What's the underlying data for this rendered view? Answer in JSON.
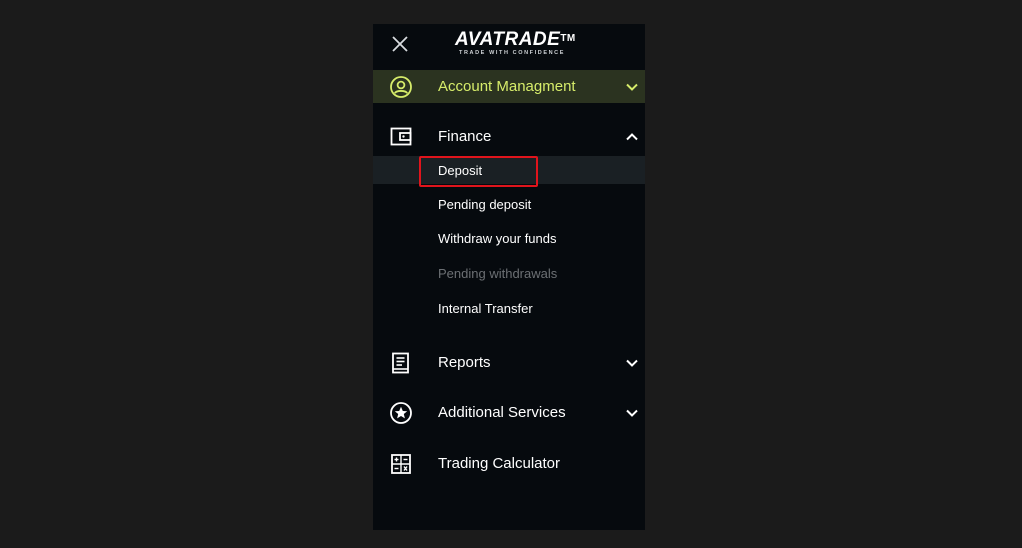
{
  "brand": {
    "name": "AVATRADE",
    "trademark": "TM",
    "tagline": "TRADE WITH CONFIDENCE"
  },
  "colors": {
    "panel_bg": "#060a0e",
    "active_bg": "#2b3320",
    "active_text": "#d6ec6a",
    "highlight": "#e0141c"
  },
  "menu": {
    "account": {
      "label": "Account Managment",
      "icon": "user-circle-icon",
      "expanded": false
    },
    "finance": {
      "label": "Finance",
      "icon": "wallet-icon",
      "expanded": true,
      "items": [
        {
          "label": "Deposit",
          "selected": true
        },
        {
          "label": "Pending deposit"
        },
        {
          "label": "Withdraw your funds"
        },
        {
          "label": "Pending withdrawals",
          "disabled": true
        },
        {
          "label": "Internal Transfer"
        }
      ]
    },
    "reports": {
      "label": "Reports",
      "icon": "document-icon",
      "expanded": false
    },
    "additional_services": {
      "label": "Additional Services",
      "icon": "star-circle-icon",
      "expanded": false
    },
    "trading_calculator": {
      "label": "Trading Calculator",
      "icon": "calculator-icon"
    }
  }
}
